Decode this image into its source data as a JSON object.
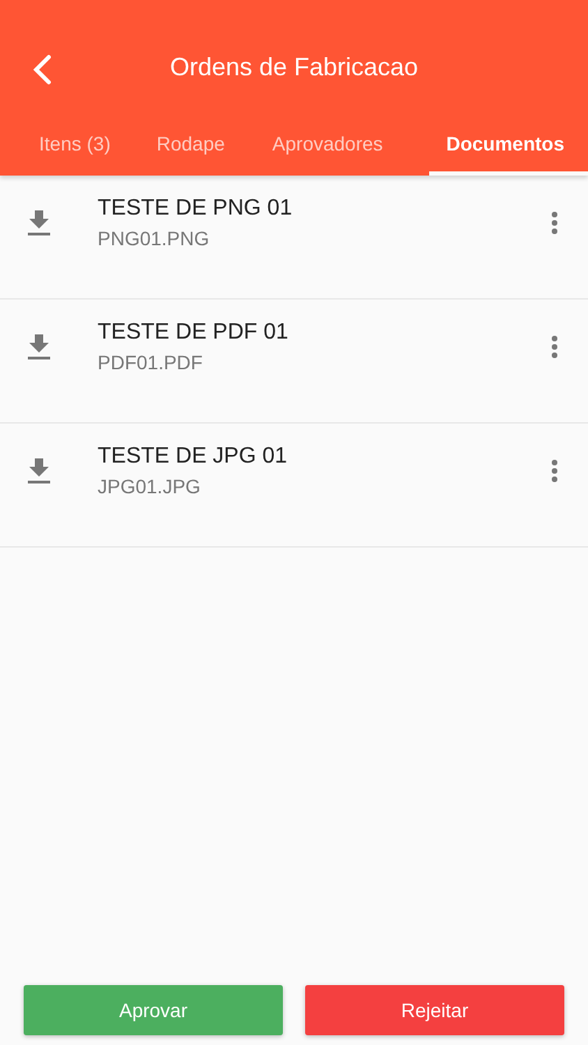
{
  "header": {
    "title": "Ordens de Fabricacao"
  },
  "tabs": [
    {
      "label": "Itens (3)",
      "selected": false
    },
    {
      "label": "Rodape",
      "selected": false
    },
    {
      "label": "Aprovadores",
      "selected": false
    },
    {
      "label": "Documentos",
      "selected": true
    }
  ],
  "documents": [
    {
      "title": "TESTE DE PNG 01",
      "file": "PNG01.PNG"
    },
    {
      "title": "TESTE DE PDF 01",
      "file": "PDF01.PDF"
    },
    {
      "title": "TESTE DE JPG 01",
      "file": "JPG01.JPG"
    }
  ],
  "buttons": [
    {
      "label": "Aprovar",
      "kind": "approve"
    },
    {
      "label": "Rejeitar",
      "kind": "reject"
    }
  ]
}
